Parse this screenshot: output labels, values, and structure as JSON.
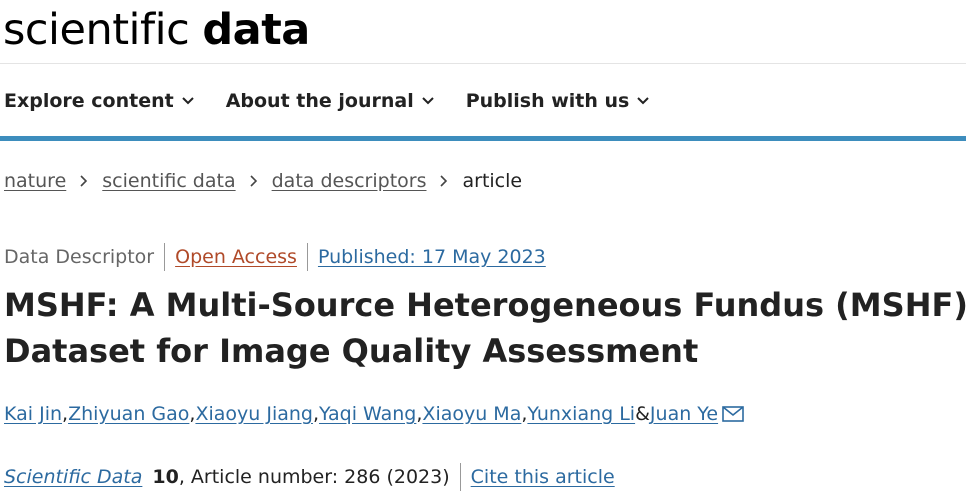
{
  "logo": {
    "light": "scientific ",
    "bold": "data"
  },
  "nav": [
    {
      "label": "Explore content"
    },
    {
      "label": "About the journal"
    },
    {
      "label": "Publish with us"
    }
  ],
  "breadcrumb": [
    {
      "label": "nature"
    },
    {
      "label": "scientific data"
    },
    {
      "label": "data descriptors"
    },
    {
      "label": "article"
    }
  ],
  "meta": {
    "type": "Data Descriptor",
    "access": "Open Access",
    "published": "Published: 17 May 2023"
  },
  "title": {
    "line1": "MSHF: A Multi-Source Heterogeneous Fundus (MSHF)",
    "line2": "Dataset for Image Quality Assessment"
  },
  "authors": [
    "Kai Jin",
    "Zhiyuan Gao",
    "Xiaoyu Jiang",
    "Yaqi Wang",
    "Xiaoyu Ma",
    "Yunxiang Li",
    "Juan Ye"
  ],
  "author_separators": {
    "comma": ", ",
    "and": " & "
  },
  "citation": {
    "journal": "Scientific Data",
    "volume": "10",
    "article": ", Article number: 286 (2023)",
    "cite_link": "Cite this article"
  },
  "icons": {
    "chevron": "chevron-down-icon",
    "breadcrumb_sep": "chevron-right-icon",
    "mail": "mail-icon"
  },
  "colors": {
    "accent_bar": "#3d8dbd",
    "link": "#2c6aa0",
    "open_access": "#b04a29"
  }
}
